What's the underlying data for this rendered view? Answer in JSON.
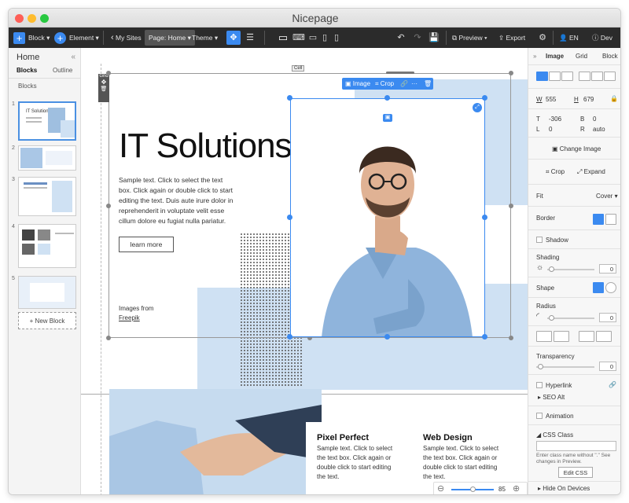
{
  "window": {
    "title": "Nicepage"
  },
  "toolbar": {
    "block": "Block",
    "element": "Element",
    "my_sites": "My Sites",
    "page": "Page: Home",
    "theme": "Theme",
    "preview": "Preview",
    "export": "Export",
    "lang": "EN",
    "dev": "Dev"
  },
  "left_panel": {
    "title": "Home",
    "tabs": [
      "Blocks",
      "Outline"
    ],
    "section": "Blocks",
    "thumbs": [
      "1",
      "2",
      "3",
      "4",
      "5"
    ],
    "new_block": "New Block",
    "thumb1_title": "IT Solutions"
  },
  "canvas": {
    "grid_badge": "Grid",
    "cell_badge": "Cell",
    "heading": "IT Solutions",
    "body": "Sample text. Click to select the text box. Click again or double click to start editing the text. Duis aute irure dolor in reprehenderit in voluptate velit esse cillum dolore eu fugiat nulla pariatur.",
    "button": "learn more",
    "images_from": "Images from",
    "freepik": "Freepik",
    "image_toolbar": {
      "image": "Image",
      "crop": "Crop",
      "more": "···"
    },
    "card1": {
      "title": "Pixel Perfect",
      "body": "Sample text. Click to select the text box. Click again or double click to start editing the text."
    },
    "card2": {
      "title": "Web Design",
      "body": "Sample text. Click to select the text box. Click again or double click to start editing the text."
    },
    "zoom": "85"
  },
  "right_panel": {
    "tabs": [
      "Image",
      "Grid",
      "Block"
    ],
    "w_label": "W",
    "w_value": "555",
    "h_label": "H",
    "h_value": "679",
    "t_label": "T",
    "t_value": "-306",
    "b_label": "B",
    "b_value": "0",
    "l_label": "L",
    "l_value": "0",
    "r_label": "R",
    "r_value": "auto",
    "change_image": "Change Image",
    "crop": "Crop",
    "expand": "Expand",
    "fit_label": "Fit",
    "fit_value": "Cover",
    "border": "Border",
    "shadow": "Shadow",
    "shading": "Shading",
    "shading_value": "0",
    "shape": "Shape",
    "radius": "Radius",
    "radius_value": "0",
    "transparency": "Transparency",
    "transparency_value": "0",
    "hyperlink": "Hyperlink",
    "seo_alt": "SEO Alt",
    "animation": "Animation",
    "css_class": "CSS Class",
    "css_hint": "Enter class name without \".\" See changes in Preview.",
    "edit_css": "Edit CSS",
    "hide_on_devices": "Hide On Devices"
  },
  "colors": {
    "accent": "#3b8af0",
    "toolbar_bg": "#2b2b2b",
    "light_blue": "#cfe1f3"
  }
}
